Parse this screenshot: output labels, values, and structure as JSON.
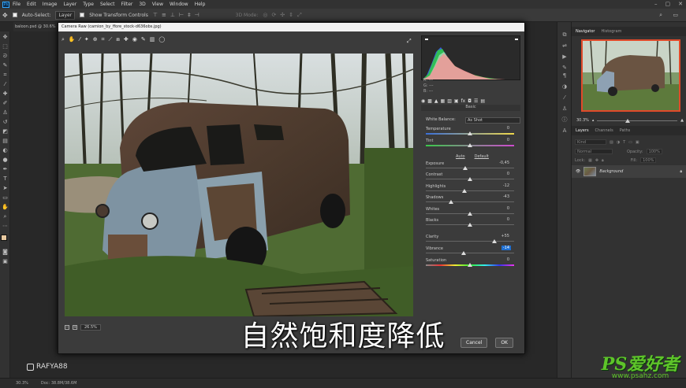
{
  "menubar": {
    "logo": "Ps",
    "items": [
      "File",
      "Edit",
      "Image",
      "Layer",
      "Type",
      "Select",
      "Filter",
      "3D",
      "View",
      "Window",
      "Help"
    ]
  },
  "optionsbar": {
    "auto_select_label": "Auto-Select:",
    "auto_select_value": "Layer",
    "transform_label": "Show Transform Controls",
    "mode_label": "3D Mode:"
  },
  "document": {
    "tab_label": "baloon.psd @ 30.6%"
  },
  "statusbar": {
    "zoom": "30.3%",
    "doc_info": "Doc: 38.8M/38.6M"
  },
  "navigator": {
    "tabs": [
      "Navigator",
      "Histogram"
    ],
    "zoom": "30.3%"
  },
  "layers": {
    "tabs": [
      "Layers",
      "Channels",
      "Paths"
    ],
    "kind_label": "Kind",
    "blend_mode": "Normal",
    "opacity_label": "Opacity:",
    "opacity_value": "100%",
    "lock_label": "Lock:",
    "fill_label": "Fill:",
    "fill_value": "100%",
    "layer_name": "Background"
  },
  "camera_raw": {
    "title": "Camera Raw (camion_by_ffore_stock-d636obs.jpg)",
    "rgb_labels": [
      "R:",
      "G:",
      "B:"
    ],
    "rgb_values": [
      "---",
      "---",
      "---"
    ],
    "panel_title": "Basic",
    "white_balance_label": "White Balance:",
    "white_balance_value": "As Shot",
    "auto_label": "Auto",
    "default_label": "Default",
    "zoom_value": "26.5%",
    "cancel_label": "Cancel",
    "ok_label": "OK",
    "sliders": [
      {
        "label": "Temperature",
        "value": "0",
        "pos": 0.5,
        "track": "temp"
      },
      {
        "label": "Tint",
        "value": "0",
        "pos": 0.5,
        "track": "tint"
      },
      {
        "label": "Exposure",
        "value": "-0,45",
        "pos": 0.45,
        "track": "plain"
      },
      {
        "label": "Contrast",
        "value": "0",
        "pos": 0.5,
        "track": "plain"
      },
      {
        "label": "Highlights",
        "value": "-12",
        "pos": 0.44,
        "track": "plain"
      },
      {
        "label": "Shadows",
        "value": "-43",
        "pos": 0.29,
        "track": "plain"
      },
      {
        "label": "Whites",
        "value": "0",
        "pos": 0.5,
        "track": "plain"
      },
      {
        "label": "Blacks",
        "value": "0",
        "pos": 0.5,
        "track": "plain"
      },
      {
        "label": "Clarity",
        "value": "+55",
        "pos": 0.78,
        "track": "plain"
      },
      {
        "label": "Vibrance",
        "value": "-14",
        "pos": 0.43,
        "track": "plain",
        "highlight": true
      },
      {
        "label": "Saturation",
        "value": "0",
        "pos": 0.5,
        "track": "sat"
      }
    ]
  },
  "overlays": {
    "subtitle": "自然饱和度降低",
    "watermark_handle": "RAFYA88",
    "site_logo": "PS爱好者",
    "site_url": "www.psahz.com"
  }
}
